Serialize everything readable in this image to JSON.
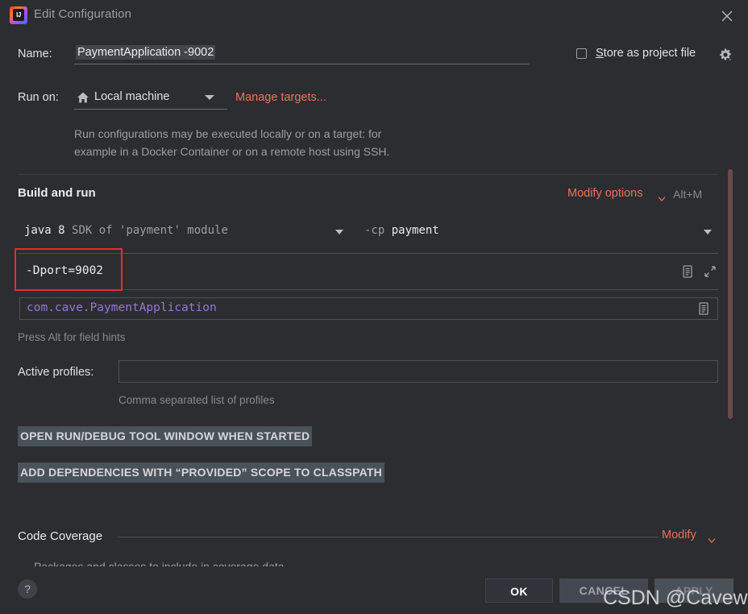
{
  "window": {
    "title": "Edit Configuration",
    "logo_icon": "intellij-idea-logo",
    "close_icon": "close-icon"
  },
  "name_row": {
    "label": "Name:",
    "value": "PaymentApplication -9002",
    "store_as_project_file": {
      "mnemonic": "S",
      "rest": "tore as project file",
      "checked": false,
      "gear_icon": "gear-icon"
    }
  },
  "run_on": {
    "label": "Run on:",
    "value": "Local machine",
    "home_icon": "home-icon",
    "dropdown_icon": "chevron-down-icon",
    "manage_targets_link": "Manage targets...",
    "description_line1": "Run configurations may be executed locally or on a target: for",
    "description_line2": "example in a Docker Container or on a remote host using SSH."
  },
  "build_and_run": {
    "section_title": "Build and run",
    "modify_options_link": "Modify options",
    "modify_options_chevron": "chevron-down-icon",
    "shortcut": "Alt+M",
    "sdk": {
      "name": "java 8",
      "description": "SDK of 'payment' module",
      "dropdown_icon": "chevron-down-icon"
    },
    "classpath": {
      "flag": "-cp",
      "module": "payment",
      "dropdown_icon": "chevron-down-icon"
    },
    "vm_options": {
      "value": "-Dport=9002",
      "macro_icon": "document-list-icon",
      "expand_icon": "expand-arrows-icon"
    },
    "main_class": {
      "value": "com.cave.PaymentApplication",
      "macro_icon": "document-list-icon"
    },
    "field_hint": "Press Alt for field hints"
  },
  "active_profiles": {
    "label": "Active profiles:",
    "value": "",
    "description": "Comma separated list of profiles"
  },
  "options": [
    "OPEN RUN/DEBUG TOOL WINDOW WHEN STARTED",
    "ADD DEPENDENCIES WITH “PROVIDED” SCOPE TO CLASSPATH"
  ],
  "code_coverage": {
    "section_title": "Code Coverage",
    "modify_link": "Modify",
    "modify_chevron": "chevron-down-icon",
    "clipped_text": "Packages and classes to include in coverage data"
  },
  "footer": {
    "help_icon": "?",
    "ok_label": "OK",
    "cancel_label": "CANCEL",
    "apply_label": "APPLY"
  },
  "watermark": "CSDN @Cavewang",
  "colors": {
    "dialog_background": "#2b2d30",
    "accent_link": "#f0705a",
    "annotation_red": "#ec2b2b",
    "main_class_purple": "#9876dc",
    "option_highlight": "#4a5259",
    "scrollbar_thumb": "#6b4a4a"
  }
}
